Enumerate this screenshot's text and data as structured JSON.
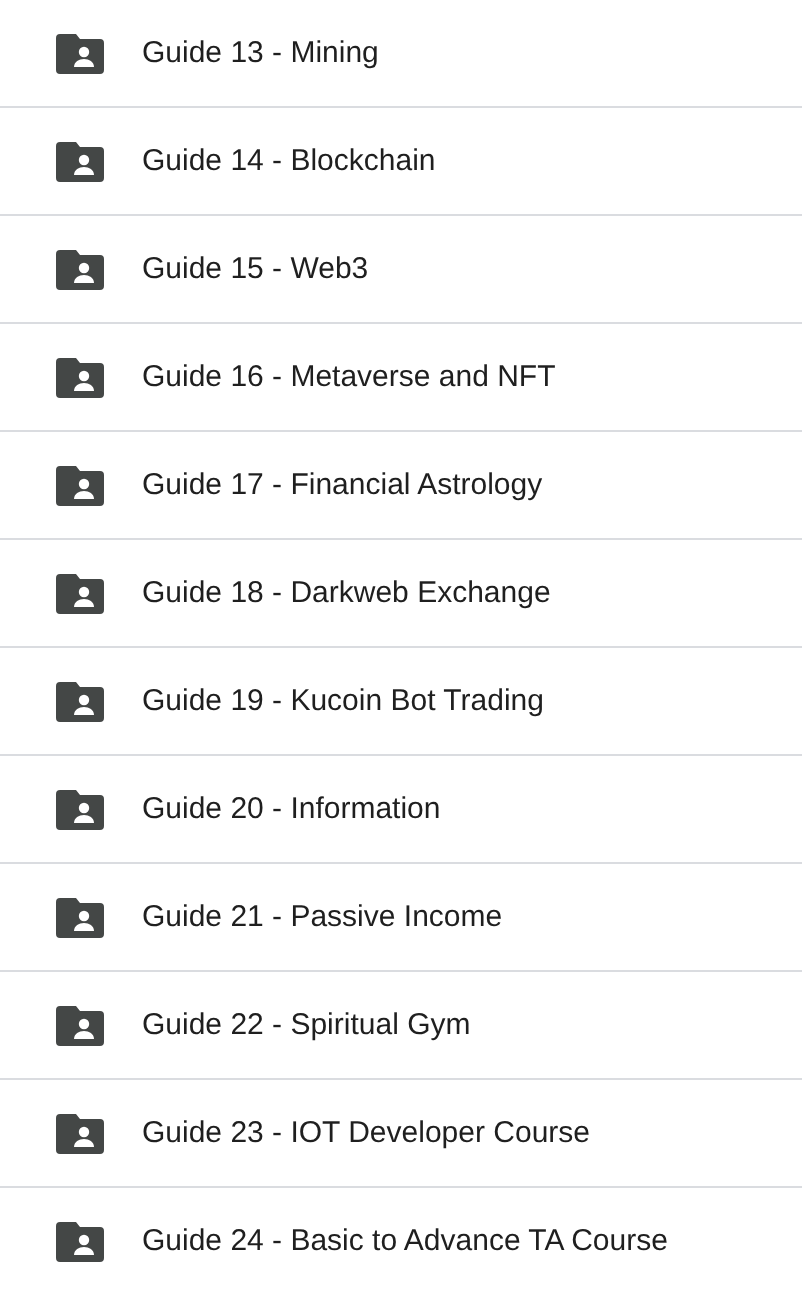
{
  "folders": [
    {
      "name": "Guide 13 - Mining"
    },
    {
      "name": "Guide 14 - Blockchain"
    },
    {
      "name": "Guide 15 - Web3"
    },
    {
      "name": "Guide 16 - Metaverse and NFT"
    },
    {
      "name": "Guide 17 - Financial Astrology"
    },
    {
      "name": "Guide 18 - Darkweb Exchange"
    },
    {
      "name": "Guide 19 - Kucoin Bot Trading"
    },
    {
      "name": "Guide 20 - Information"
    },
    {
      "name": "Guide 21 - Passive Income"
    },
    {
      "name": "Guide 22 - Spiritual Gym"
    },
    {
      "name": "Guide 23 - IOT Developer Course"
    },
    {
      "name": "Guide 24 - Basic to Advance TA Course"
    }
  ]
}
